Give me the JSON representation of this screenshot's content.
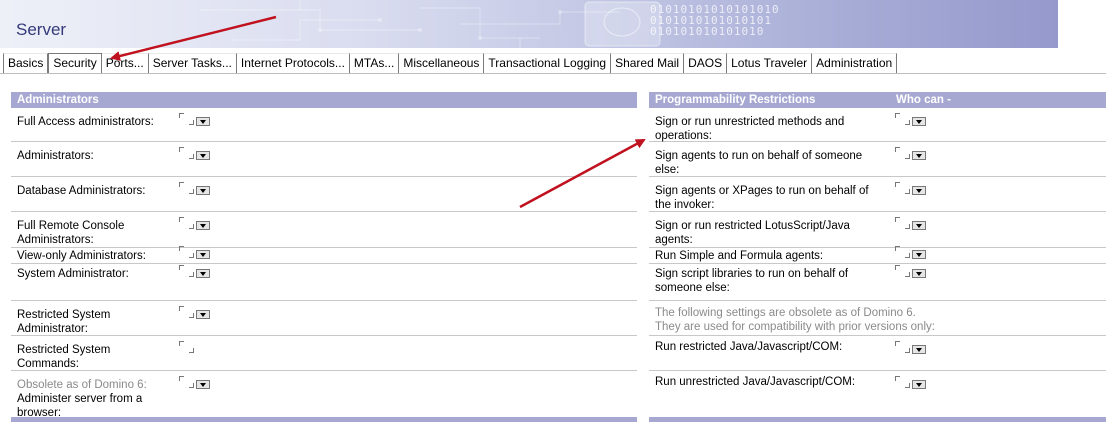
{
  "window": {
    "title": "Server"
  },
  "banner": {
    "binary_lines": [
      "01010101010101010",
      "0101010101010101",
      "010101010101010"
    ]
  },
  "tabs": [
    {
      "label": "Basics"
    },
    {
      "label": "Security",
      "active": true
    },
    {
      "label": "Ports..."
    },
    {
      "label": "Server Tasks..."
    },
    {
      "label": "Internet Protocols..."
    },
    {
      "label": "MTAs..."
    },
    {
      "label": "Miscellaneous"
    },
    {
      "label": "Transactional Logging"
    },
    {
      "label": "Shared Mail"
    },
    {
      "label": "DAOS"
    },
    {
      "label": "Lotus Traveler"
    },
    {
      "label": "Administration"
    }
  ],
  "administrators": {
    "header": "Administrators",
    "rows": [
      {
        "label": "Full Access administrators:"
      },
      {
        "label": "Administrators:"
      },
      {
        "label": "Database Administrators:"
      },
      {
        "label": "Full Remote Console Administrators:"
      },
      {
        "label": "View-only Administrators:"
      },
      {
        "label": "System Administrator:"
      },
      {
        "label": "Restricted System Administrator:"
      },
      {
        "label": "Restricted System Commands:"
      },
      {
        "muted": "Obsolete as of Domino 6:",
        "label": "Administer server from a browser:"
      }
    ]
  },
  "programmability": {
    "header": "Programmability  Restrictions",
    "header_col2": "Who can -",
    "rows": [
      {
        "label": "Sign or run unrestricted methods and operations:"
      },
      {
        "label": "Sign agents to run on behalf of someone else:"
      },
      {
        "label": "Sign agents or XPages to run on behalf of the invoker:"
      },
      {
        "label": "Sign or run restricted LotusScript/Java agents:"
      },
      {
        "label": "Run Simple and Formula agents:"
      },
      {
        "label": "Sign script libraries to run on behalf of someone else:"
      }
    ],
    "obsolete_note": "The following settings are obsolete as of Domino 6.",
    "obsolete_note2": "They are used for compatibility with prior versions only:",
    "obsolete_rows": [
      {
        "label": "Run restricted Java/Javascript/COM:"
      },
      {
        "label": "Run unrestricted Java/Javascript/COM:"
      }
    ]
  },
  "colors": {
    "section_header": "#a6a8d2",
    "banner_title": "#333a7a",
    "arrow": "#c0111f"
  }
}
